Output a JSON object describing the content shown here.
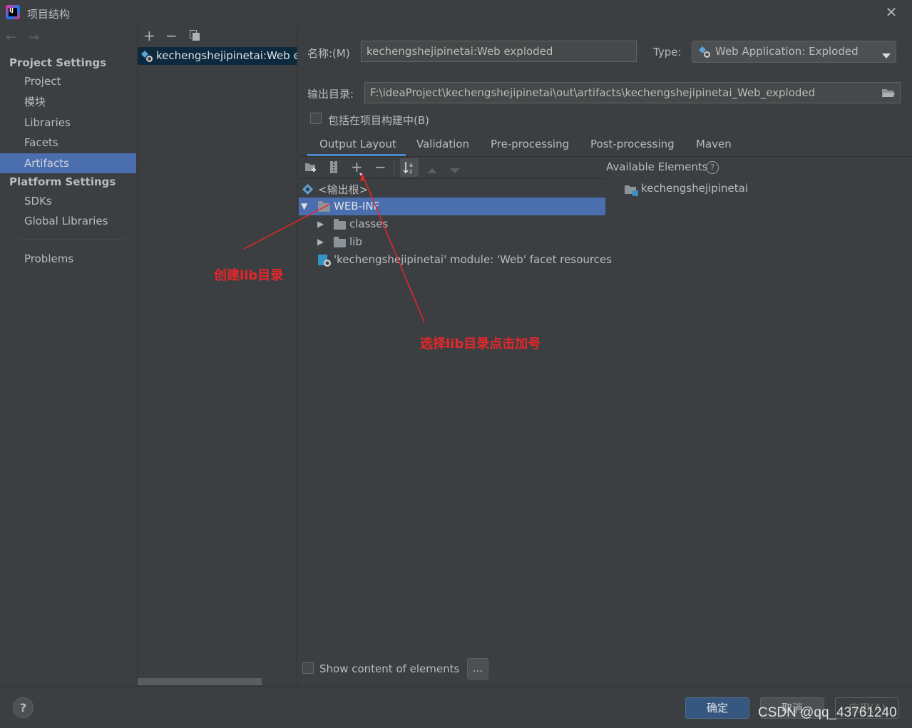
{
  "window": {
    "title": "项目结构"
  },
  "sidebar": {
    "project_settings_header": "Project Settings",
    "project_items": [
      {
        "label": "Project"
      },
      {
        "label": "模块"
      },
      {
        "label": "Libraries"
      },
      {
        "label": "Facets"
      },
      {
        "label": "Artifacts",
        "selected": true
      }
    ],
    "platform_settings_header": "Platform Settings",
    "platform_items": [
      {
        "label": "SDKs"
      },
      {
        "label": "Global Libraries"
      }
    ],
    "problems_label": "Problems"
  },
  "artifact_list": {
    "items": [
      {
        "label": "kechengshejipinetai:Web exploded",
        "selected": true
      }
    ]
  },
  "form": {
    "name_label": "名称:(M)",
    "name_value": "kechengshejipinetai:Web exploded",
    "type_label": "Type:",
    "type_value": "Web Application: Exploded",
    "output_label": "输出目录:",
    "output_value": "F:\\ideaProject\\kechengshejipinetai\\out\\artifacts\\kechengshejipinetai_Web_exploded",
    "include_label": "包括在项目构建中(B)",
    "include_checked": false
  },
  "tabs": [
    {
      "label": "Output Layout",
      "active": true
    },
    {
      "label": "Validation"
    },
    {
      "label": "Pre-processing"
    },
    {
      "label": "Post-processing"
    },
    {
      "label": "Maven"
    }
  ],
  "layout_tree": {
    "root": "<输出根>",
    "web_inf": "WEB-INF",
    "classes": "classes",
    "lib": "lib",
    "facet_resources": "'kechengshejipinetai' module: 'Web' facet resources"
  },
  "available": {
    "header": "Available Elements",
    "items": [
      {
        "label": "kechengshejipinetai"
      }
    ]
  },
  "show_content_label": "Show content of elements",
  "ellipsis_label": "...",
  "annotations": {
    "create_lib": "创建lib目录",
    "select_lib": "选择lib目录点击加号"
  },
  "buttons": {
    "help": "?",
    "ok": "确定",
    "cancel": "取消",
    "apply": "应用(A)"
  },
  "watermark": "CSDN @qq_43761240",
  "colors": {
    "background": "#3c3f41",
    "selection": "#4b6eaf",
    "annotation_red": "#e8262a",
    "primary_button": "#365880"
  }
}
